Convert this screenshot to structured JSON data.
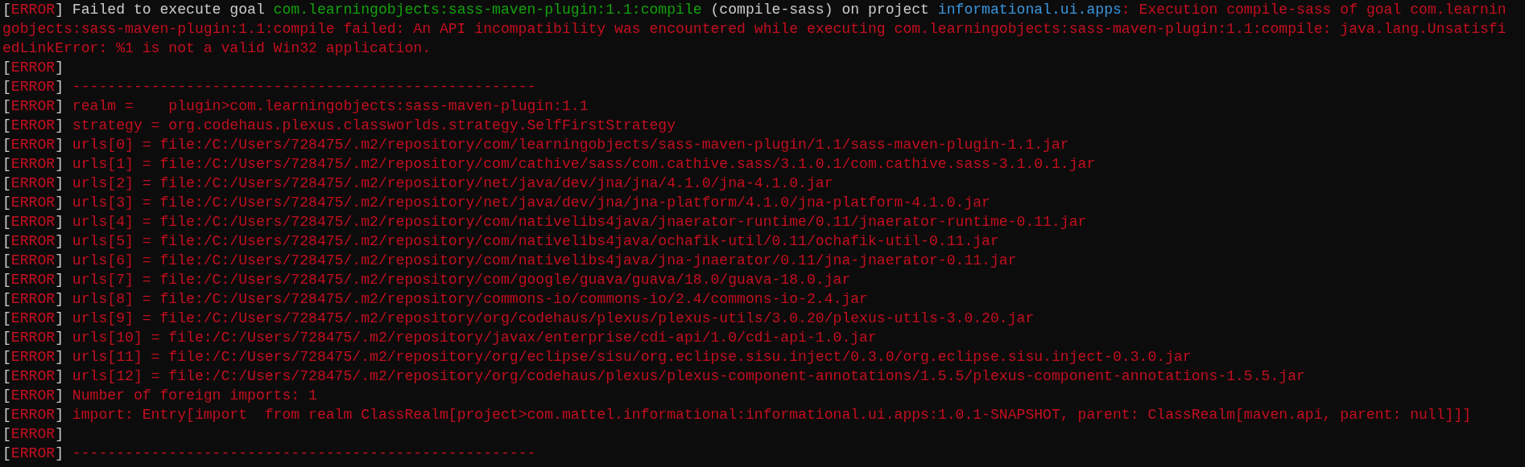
{
  "terminal": {
    "lines": [
      {
        "tag": {
          "open": "[",
          "label": "ERROR",
          "close": "]"
        },
        "segments": [
          {
            "kind": "plain",
            "text": " Failed to execute goal "
          },
          {
            "kind": "module",
            "text": "com.learningobjects:sass-maven-plugin:1.1:compile"
          },
          {
            "kind": "plain",
            "text": " (compile-sass) on project "
          },
          {
            "kind": "project",
            "text": "informational.ui.apps"
          },
          {
            "kind": "error",
            "text": ": Execution compile-sass of goal com.learnin"
          }
        ]
      },
      {
        "segments": [
          {
            "kind": "error",
            "text": "gobjects:sass-maven-plugin:1.1:compile failed: An API incompatibility was encountered while executing com.learningobjects:sass-maven-plugin:1.1:compile: java.lang.Unsatisfi"
          }
        ]
      },
      {
        "segments": [
          {
            "kind": "error",
            "text": "edLinkError: %1 is not a valid Win32 application."
          }
        ]
      },
      {
        "tag": {
          "open": "[",
          "label": "ERROR",
          "close": "]"
        }
      },
      {
        "tag": {
          "open": "[",
          "label": "ERROR",
          "close": "]"
        },
        "segments": [
          {
            "kind": "error",
            "text": " -----------------------------------------------------"
          }
        ]
      },
      {
        "tag": {
          "open": "[",
          "label": "ERROR",
          "close": "]"
        },
        "segments": [
          {
            "kind": "error",
            "text": " realm =    plugin>com.learningobjects:sass-maven-plugin:1.1"
          }
        ]
      },
      {
        "tag": {
          "open": "[",
          "label": "ERROR",
          "close": "]"
        },
        "segments": [
          {
            "kind": "error",
            "text": " strategy = org.codehaus.plexus.classworlds.strategy.SelfFirstStrategy"
          }
        ]
      },
      {
        "tag": {
          "open": "[",
          "label": "ERROR",
          "close": "]"
        },
        "segments": [
          {
            "kind": "error",
            "text": " urls[0] = file:/C:/Users/728475/.m2/repository/com/learningobjects/sass-maven-plugin/1.1/sass-maven-plugin-1.1.jar"
          }
        ]
      },
      {
        "tag": {
          "open": "[",
          "label": "ERROR",
          "close": "]"
        },
        "segments": [
          {
            "kind": "error",
            "text": " urls[1] = file:/C:/Users/728475/.m2/repository/com/cathive/sass/com.cathive.sass/3.1.0.1/com.cathive.sass-3.1.0.1.jar"
          }
        ]
      },
      {
        "tag": {
          "open": "[",
          "label": "ERROR",
          "close": "]"
        },
        "segments": [
          {
            "kind": "error",
            "text": " urls[2] = file:/C:/Users/728475/.m2/repository/net/java/dev/jna/jna/4.1.0/jna-4.1.0.jar"
          }
        ]
      },
      {
        "tag": {
          "open": "[",
          "label": "ERROR",
          "close": "]"
        },
        "segments": [
          {
            "kind": "error",
            "text": " urls[3] = file:/C:/Users/728475/.m2/repository/net/java/dev/jna/jna-platform/4.1.0/jna-platform-4.1.0.jar"
          }
        ]
      },
      {
        "tag": {
          "open": "[",
          "label": "ERROR",
          "close": "]"
        },
        "segments": [
          {
            "kind": "error",
            "text": " urls[4] = file:/C:/Users/728475/.m2/repository/com/nativelibs4java/jnaerator-runtime/0.11/jnaerator-runtime-0.11.jar"
          }
        ]
      },
      {
        "tag": {
          "open": "[",
          "label": "ERROR",
          "close": "]"
        },
        "segments": [
          {
            "kind": "error",
            "text": " urls[5] = file:/C:/Users/728475/.m2/repository/com/nativelibs4java/ochafik-util/0.11/ochafik-util-0.11.jar"
          }
        ]
      },
      {
        "tag": {
          "open": "[",
          "label": "ERROR",
          "close": "]"
        },
        "segments": [
          {
            "kind": "error",
            "text": " urls[6] = file:/C:/Users/728475/.m2/repository/com/nativelibs4java/jna-jnaerator/0.11/jna-jnaerator-0.11.jar"
          }
        ]
      },
      {
        "tag": {
          "open": "[",
          "label": "ERROR",
          "close": "]"
        },
        "segments": [
          {
            "kind": "error",
            "text": " urls[7] = file:/C:/Users/728475/.m2/repository/com/google/guava/guava/18.0/guava-18.0.jar"
          }
        ]
      },
      {
        "tag": {
          "open": "[",
          "label": "ERROR",
          "close": "]"
        },
        "segments": [
          {
            "kind": "error",
            "text": " urls[8] = file:/C:/Users/728475/.m2/repository/commons-io/commons-io/2.4/commons-io-2.4.jar"
          }
        ]
      },
      {
        "tag": {
          "open": "[",
          "label": "ERROR",
          "close": "]"
        },
        "segments": [
          {
            "kind": "error",
            "text": " urls[9] = file:/C:/Users/728475/.m2/repository/org/codehaus/plexus/plexus-utils/3.0.20/plexus-utils-3.0.20.jar"
          }
        ]
      },
      {
        "tag": {
          "open": "[",
          "label": "ERROR",
          "close": "]"
        },
        "segments": [
          {
            "kind": "error",
            "text": " urls[10] = file:/C:/Users/728475/.m2/repository/javax/enterprise/cdi-api/1.0/cdi-api-1.0.jar"
          }
        ]
      },
      {
        "tag": {
          "open": "[",
          "label": "ERROR",
          "close": "]"
        },
        "segments": [
          {
            "kind": "error",
            "text": " urls[11] = file:/C:/Users/728475/.m2/repository/org/eclipse/sisu/org.eclipse.sisu.inject/0.3.0/org.eclipse.sisu.inject-0.3.0.jar"
          }
        ]
      },
      {
        "tag": {
          "open": "[",
          "label": "ERROR",
          "close": "]"
        },
        "segments": [
          {
            "kind": "error",
            "text": " urls[12] = file:/C:/Users/728475/.m2/repository/org/codehaus/plexus/plexus-component-annotations/1.5.5/plexus-component-annotations-1.5.5.jar"
          }
        ]
      },
      {
        "tag": {
          "open": "[",
          "label": "ERROR",
          "close": "]"
        },
        "segments": [
          {
            "kind": "error",
            "text": " Number of foreign imports: 1"
          }
        ]
      },
      {
        "tag": {
          "open": "[",
          "label": "ERROR",
          "close": "]"
        },
        "segments": [
          {
            "kind": "error",
            "text": " import: Entry[import  from realm ClassRealm[project>com.mattel.informational:informational.ui.apps:1.0.1-SNAPSHOT, parent: ClassRealm[maven.api, parent: null]]]"
          }
        ]
      },
      {
        "tag": {
          "open": "[",
          "label": "ERROR",
          "close": "]"
        }
      },
      {
        "tag": {
          "open": "[",
          "label": "ERROR",
          "close": "]"
        },
        "segments": [
          {
            "kind": "error",
            "text": " -----------------------------------------------------"
          }
        ]
      }
    ]
  }
}
